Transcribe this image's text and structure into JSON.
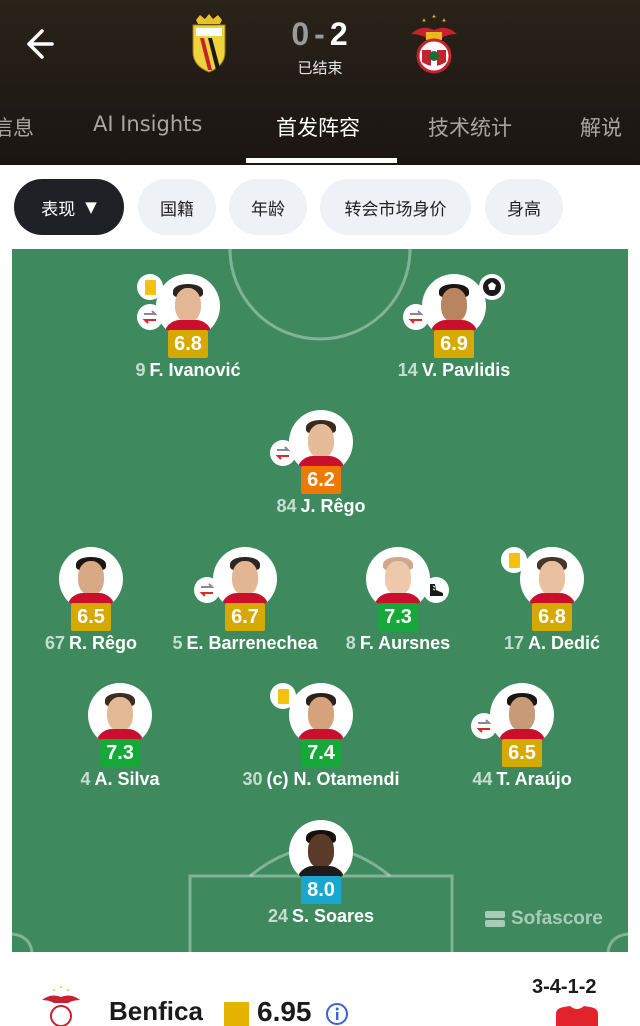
{
  "header": {
    "home_score": "0",
    "separator": "-",
    "away_score": "2",
    "status": "已结束"
  },
  "tabs": [
    {
      "label": "信息"
    },
    {
      "label": "AI Insights"
    },
    {
      "label": "首发阵容",
      "active": true
    },
    {
      "label": "技术统计"
    },
    {
      "label": "解说"
    }
  ],
  "filters": [
    {
      "label": "表现",
      "active": true
    },
    {
      "label": "国籍"
    },
    {
      "label": "年龄"
    },
    {
      "label": "转会市场身价"
    },
    {
      "label": "身高"
    }
  ],
  "rating_colors": {
    "gold": "#d7a900",
    "orange": "#ec7a00",
    "green": "#16a838",
    "blue": "#19a7cf"
  },
  "players": [
    {
      "number": "9",
      "name": "F. Ivanović",
      "rating": "6.8",
      "rating_color": "gold",
      "icons": [
        "yellow-card",
        "substitution"
      ]
    },
    {
      "number": "14",
      "name": "V. Pavlidis",
      "rating": "6.9",
      "rating_color": "gold",
      "icons": [
        "substitution",
        "goal"
      ]
    },
    {
      "number": "84",
      "name": "J. Rêgo",
      "rating": "6.2",
      "rating_color": "orange",
      "icons": [
        "substitution"
      ]
    },
    {
      "number": "67",
      "name": "R. Rêgo",
      "rating": "6.5",
      "rating_color": "gold",
      "icons": []
    },
    {
      "number": "5",
      "name": "E. Barrenechea",
      "rating": "6.7",
      "rating_color": "gold",
      "icons": [
        "substitution"
      ]
    },
    {
      "number": "8",
      "name": "F. Aursnes",
      "rating": "7.3",
      "rating_color": "green",
      "icons": [
        "assist-boot"
      ]
    },
    {
      "number": "17",
      "name": "A. Dedić",
      "rating": "6.8",
      "rating_color": "gold",
      "icons": [
        "yellow-card"
      ]
    },
    {
      "number": "4",
      "name": "A. Silva",
      "rating": "7.3",
      "rating_color": "green",
      "icons": []
    },
    {
      "number": "30",
      "name": "(c) N. Otamendi",
      "rating": "7.4",
      "rating_color": "green",
      "icons": [
        "yellow-card"
      ]
    },
    {
      "number": "44",
      "name": "T. Araújo",
      "rating": "6.5",
      "rating_color": "gold",
      "icons": [
        "substitution"
      ]
    },
    {
      "number": "24",
      "name": "S. Soares",
      "rating": "8.0",
      "rating_color": "blue",
      "icons": []
    }
  ],
  "watermark": "Sofascore",
  "footer": {
    "team": "Benfica",
    "rating": "6.95",
    "formation": "3-4-1-2"
  }
}
